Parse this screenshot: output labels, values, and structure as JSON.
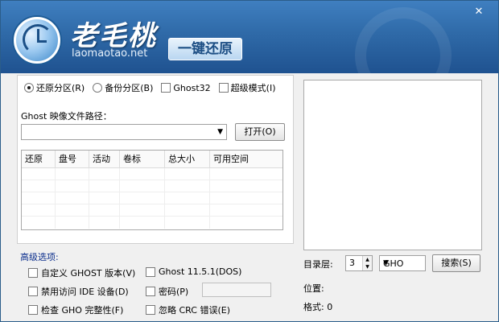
{
  "header": {
    "brand_cn": "老毛桃",
    "brand_url": "laomaotao.net",
    "title_badge": "一键还原",
    "close_glyph": "✕"
  },
  "mode": {
    "options": [
      {
        "label": "还原分区(R)",
        "selected": true
      },
      {
        "label": "备份分区(B)",
        "selected": false
      }
    ],
    "checkboxes": [
      {
        "label": "Ghost32",
        "checked": false
      },
      {
        "label": "超级模式(I)",
        "checked": false
      }
    ]
  },
  "ghost_path": {
    "label": "Ghost 映像文件路径：",
    "value": "",
    "open_button": "打开(O)"
  },
  "partition_table": {
    "columns": [
      "还原",
      "盘号",
      "活动",
      "卷标",
      "总大小",
      "可用空间"
    ],
    "rows": []
  },
  "advanced": {
    "title": "高级选项:",
    "options": [
      {
        "label": "自定义 GHOST 版本(V)",
        "checked": false
      },
      {
        "label": "Ghost 11.5.1(DOS)",
        "checked": false
      },
      {
        "label": "禁用访问 IDE 设备(D)",
        "checked": false
      },
      {
        "label": "密码(P)",
        "checked": false
      },
      {
        "label": "检查 GHO 完整性(F)",
        "checked": false
      },
      {
        "label": "忽略 CRC 错误(E)",
        "checked": false
      }
    ],
    "password_value": ""
  },
  "search": {
    "dir_level_label": "目录层:",
    "dir_level_value": "3",
    "ext_value": "GHO",
    "button": "搜索(S)"
  },
  "info": {
    "position_label": "位置:",
    "format_label": "格式: 0"
  }
}
